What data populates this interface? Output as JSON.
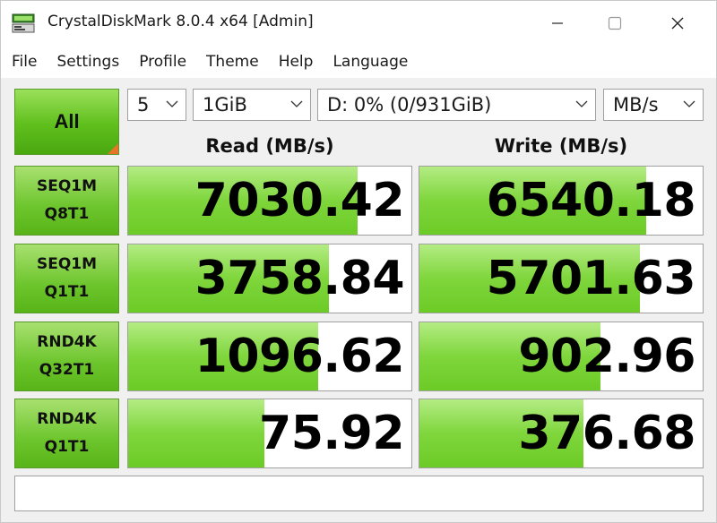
{
  "window": {
    "title": "CrystalDiskMark 8.0.4 x64 [Admin]"
  },
  "menu": [
    "File",
    "Settings",
    "Profile",
    "Theme",
    "Help",
    "Language"
  ],
  "controls": {
    "all_label": "All",
    "count_value": "5",
    "size_value": "1GiB",
    "drive_value": "D: 0% (0/931GiB)",
    "unit_value": "MB/s"
  },
  "headers": {
    "read": "Read (MB/s)",
    "write": "Write (MB/s)"
  },
  "rows": [
    {
      "line1": "SEQ1M",
      "line2": "Q8T1",
      "read": "7030.42",
      "write": "6540.18",
      "read_fill": 0.81,
      "write_fill": 0.8
    },
    {
      "line1": "SEQ1M",
      "line2": "Q1T1",
      "read": "3758.84",
      "write": "5701.63",
      "read_fill": 0.71,
      "write_fill": 0.78
    },
    {
      "line1": "RND4K",
      "line2": "Q32T1",
      "read": "1096.62",
      "write": "902.96",
      "read_fill": 0.67,
      "write_fill": 0.64
    },
    {
      "line1": "RND4K",
      "line2": "Q1T1",
      "read": "75.92",
      "write": "376.68",
      "read_fill": 0.48,
      "write_fill": 0.58
    }
  ],
  "comment": "",
  "colors": {
    "bar_green": "#7fd63c",
    "label_green": "#6cc52c",
    "corner_orange": "#e8742a"
  },
  "icons": {
    "app": "crystaldiskmark-icon",
    "minimize": "minimize-icon",
    "maximize": "maximize-icon",
    "close": "close-icon"
  }
}
